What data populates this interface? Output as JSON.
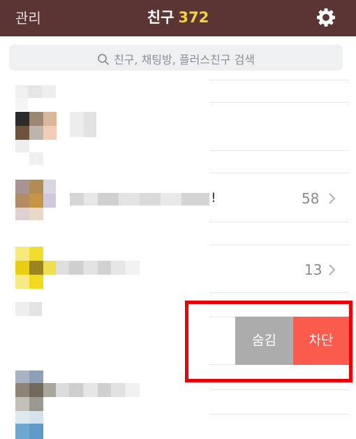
{
  "header": {
    "manage_label": "관리",
    "title_label": "친구",
    "friend_count": "372",
    "settings_icon": "gear-icon"
  },
  "search": {
    "placeholder": "친구, 채팅방, 플러스친구 검색",
    "icon": "search-icon"
  },
  "rows": [
    {
      "badge_count": "58",
      "suffix_text": "!"
    },
    {
      "badge_count": "13"
    }
  ],
  "swipe_actions": {
    "hide_label": "숨김",
    "block_label": "차단"
  },
  "colors": {
    "header_bg": "#5a3534",
    "count_accent": "#f7d23a",
    "hide_bg": "#acacac",
    "block_bg": "#fa5b4c",
    "highlight": "#e8000b"
  }
}
